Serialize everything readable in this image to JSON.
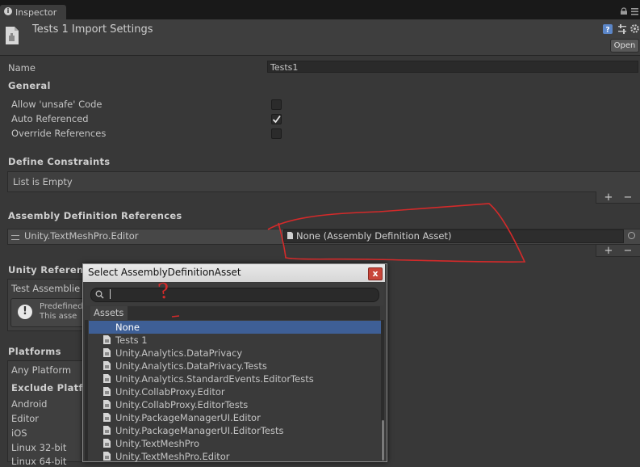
{
  "window": {
    "tab_label": "Inspector"
  },
  "header": {
    "title": "Tests 1 Import Settings",
    "open_label": "Open"
  },
  "fields": {
    "name_label": "Name",
    "name_value": "Tests1"
  },
  "general": {
    "heading": "General",
    "options": [
      {
        "label": "Allow 'unsafe' Code",
        "checked": false
      },
      {
        "label": "Auto Referenced",
        "checked": true
      },
      {
        "label": "Override References",
        "checked": false
      }
    ]
  },
  "define_constraints": {
    "heading": "Define Constraints",
    "empty_text": "List is Empty",
    "add_label": "+",
    "remove_label": "−"
  },
  "assembly_refs": {
    "heading": "Assembly Definition References",
    "item_label": "Unity.TextMeshPro.Editor",
    "item_value": "None (Assembly Definition Asset)",
    "add_label": "+",
    "remove_label": "−"
  },
  "unity_refs": {
    "heading": "Unity Referen",
    "test_label": "Test Assemblie",
    "help_line1": "Predefined",
    "help_line2": "This asse"
  },
  "platforms": {
    "heading": "Platforms",
    "any_platform": "Any Platform",
    "exclude_heading": "Exclude Platf",
    "items": [
      "Android",
      "Editor",
      "iOS",
      "Linux 32-bit",
      "Linux 64-bit"
    ]
  },
  "dialog": {
    "title": "Select AssemblyDefinitionAsset",
    "close_glyph": "x",
    "search_value": "",
    "assets_tab": "Assets",
    "results": [
      {
        "label": "None",
        "selected": true,
        "icon": false
      },
      {
        "label": "Tests 1",
        "selected": false,
        "icon": true
      },
      {
        "label": "Unity.Analytics.DataPrivacy",
        "selected": false,
        "icon": true
      },
      {
        "label": "Unity.Analytics.DataPrivacy.Tests",
        "selected": false,
        "icon": true
      },
      {
        "label": "Unity.Analytics.StandardEvents.EditorTests",
        "selected": false,
        "icon": true
      },
      {
        "label": "Unity.CollabProxy.Editor",
        "selected": false,
        "icon": true
      },
      {
        "label": "Unity.CollabProxy.EditorTests",
        "selected": false,
        "icon": true
      },
      {
        "label": "Unity.PackageManagerUI.Editor",
        "selected": false,
        "icon": true
      },
      {
        "label": "Unity.PackageManagerUI.EditorTests",
        "selected": false,
        "icon": true
      },
      {
        "label": "Unity.TextMeshPro",
        "selected": false,
        "icon": true
      },
      {
        "label": "Unity.TextMeshPro.Editor",
        "selected": false,
        "icon": true
      }
    ]
  },
  "annotations": {
    "color": "#d42a2a",
    "question_mark": "?"
  }
}
